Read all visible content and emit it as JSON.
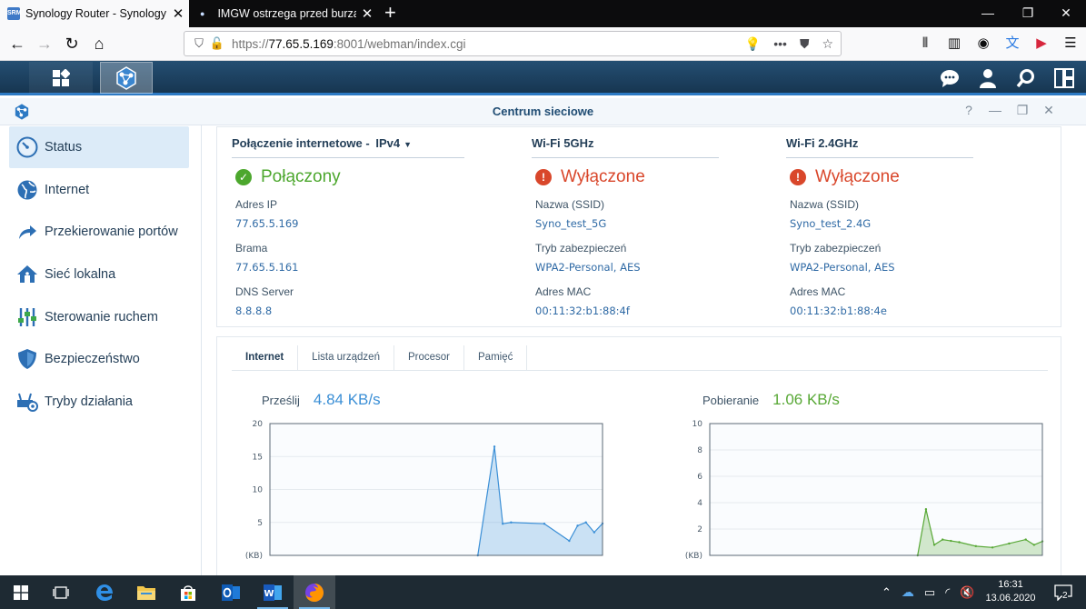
{
  "browser": {
    "tabs": [
      {
        "title": "Synology Router - SynologyRo",
        "favicon": "SRM",
        "active": true
      },
      {
        "title": "IMGW ostrzega przed burzami",
        "active": false
      }
    ],
    "new_tab": "+",
    "window_controls": [
      "minimize",
      "restore",
      "close"
    ],
    "url_prefix": "https://",
    "url_host": "77.65.5.169",
    "url_rest": ":8001/webman/index.cgi",
    "page_actions": "•••"
  },
  "srm": {
    "window_title": "Centrum sieciowe",
    "sidebar": [
      {
        "label": "Status",
        "icon": "speedometer-icon",
        "active": true
      },
      {
        "label": "Internet",
        "icon": "globe-icon"
      },
      {
        "label": "Przekierowanie portów",
        "icon": "arrow-forward-icon"
      },
      {
        "label": "Sieć lokalna",
        "icon": "home-network-icon"
      },
      {
        "label": "Sterowanie ruchem",
        "icon": "sliders-icon"
      },
      {
        "label": "Bezpieczeństwo",
        "icon": "shield-icon"
      },
      {
        "label": "Tryby działania",
        "icon": "router-gear-icon"
      }
    ],
    "internet": {
      "header": "Połączenie internetowe -",
      "protocol": "IPv4",
      "status": "Połączony",
      "fields": [
        {
          "label": "Adres IP",
          "value": "77.65.5.169"
        },
        {
          "label": "Brama",
          "value": "77.65.5.161"
        },
        {
          "label": "DNS Server",
          "value": "8.8.8.8"
        }
      ]
    },
    "wifi5": {
      "header": "Wi-Fi 5GHz",
      "status": "Wyłączone",
      "fields": [
        {
          "label": "Nazwa (SSID)",
          "value": "Syno_test_5G"
        },
        {
          "label": "Tryb zabezpieczeń",
          "value": "WPA2-Personal, AES"
        },
        {
          "label": "Adres MAC",
          "value": "00:11:32:b1:88:4f"
        }
      ]
    },
    "wifi24": {
      "header": "Wi-Fi 2.4GHz",
      "status": "Wyłączone",
      "fields": [
        {
          "label": "Nazwa (SSID)",
          "value": "Syno_test_2.4G"
        },
        {
          "label": "Tryb zabezpieczeń",
          "value": "WPA2-Personal, AES"
        },
        {
          "label": "Adres MAC",
          "value": "00:11:32:b1:88:4e"
        }
      ]
    },
    "tabs": [
      "Internet",
      "Lista urządzeń",
      "Procesor",
      "Pamięć"
    ],
    "upload": {
      "label": "Prześlij",
      "value": "4.84 KB/s"
    },
    "download": {
      "label": "Pobieranie",
      "value": "1.06 KB/s"
    }
  },
  "chart_data": [
    {
      "type": "area",
      "name": "Prześlij",
      "ylabel": "(KB)",
      "ylim": [
        0,
        20
      ],
      "yticks": [
        5,
        10,
        15,
        20
      ],
      "xlim": [
        0,
        40
      ],
      "color": "#3b8fd6",
      "x": [
        25,
        27,
        28,
        29,
        33,
        36,
        37,
        38,
        39,
        40
      ],
      "y": [
        0,
        16.5,
        4.8,
        5.0,
        4.8,
        2.2,
        4.5,
        5.0,
        3.5,
        4.84
      ]
    },
    {
      "type": "area",
      "name": "Pobieranie",
      "ylabel": "(KB)",
      "ylim": [
        0,
        10
      ],
      "yticks": [
        2,
        4,
        6,
        8,
        10
      ],
      "xlim": [
        0,
        40
      ],
      "color": "#58a836",
      "x": [
        25,
        26,
        27,
        28,
        29,
        30,
        32,
        34,
        36,
        38,
        39,
        40
      ],
      "y": [
        0,
        3.5,
        0.8,
        1.2,
        1.1,
        1.0,
        0.7,
        0.6,
        0.9,
        1.2,
        0.8,
        1.06
      ]
    }
  ],
  "taskbar": {
    "time": "16:31",
    "date": "13.06.2020",
    "notifications": "2"
  },
  "colors": {
    "accent": "#2d7ac4",
    "ok": "#4ca72d",
    "error": "#d9472b"
  }
}
